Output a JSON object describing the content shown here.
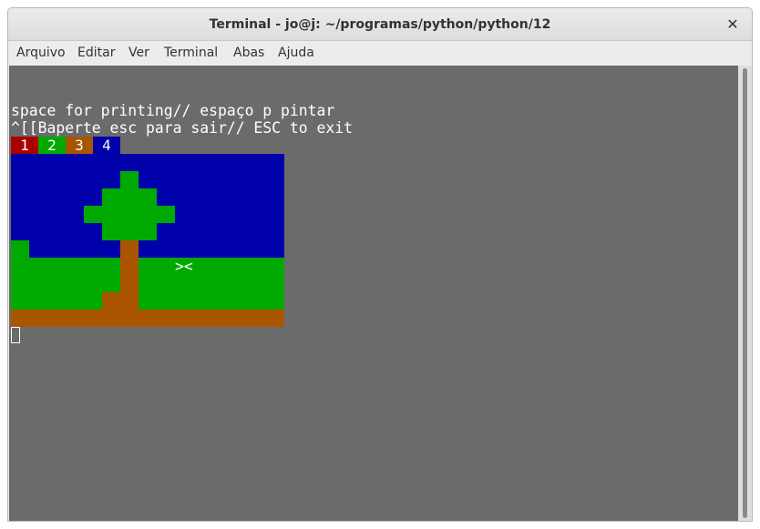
{
  "window": {
    "title": "Terminal - jo@j: ~/programas/python/python/12",
    "close_glyph": "✕"
  },
  "menu": [
    "Arquivo",
    "Editar",
    "Ver",
    "Terminal",
    "Abas",
    "Ajuda"
  ],
  "terminal": {
    "line1": "space for printing// espaço p pintar",
    "line2": "^[[Baperte esc para sair// ESC to exit",
    "palette": [
      {
        "label": "1",
        "color": "#aa0000"
      },
      {
        "label": "2",
        "color": "#00aa00"
      },
      {
        "label": "3",
        "color": "#aa5500"
      },
      {
        "label": "4",
        "color": "#0000aa"
      }
    ],
    "marker": "><"
  },
  "colors": {
    "sky": "#0000aa",
    "grass": "#00aa00",
    "trunk": "#aa5500",
    "background": "#6b6b6b"
  }
}
